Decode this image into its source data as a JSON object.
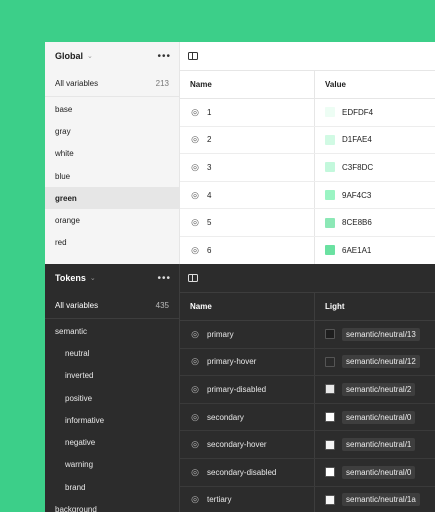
{
  "light_panel": {
    "collection_name": "Global",
    "all_variables_label": "All variables",
    "all_variables_count": "213",
    "groups": [
      {
        "label": "base",
        "selected": false
      },
      {
        "label": "gray",
        "selected": false
      },
      {
        "label": "white",
        "selected": false
      },
      {
        "label": "blue",
        "selected": false
      },
      {
        "label": "green",
        "selected": true
      },
      {
        "label": "orange",
        "selected": false
      },
      {
        "label": "red",
        "selected": false
      }
    ],
    "columns": {
      "name": "Name",
      "value": "Value"
    },
    "rows": [
      {
        "name": "1",
        "value": "EDFDF4",
        "color": "#EDFDF4"
      },
      {
        "name": "2",
        "value": "D1FAE4",
        "color": "#D1FAE4"
      },
      {
        "name": "3",
        "value": "C3F8DC",
        "color": "#C3F8DC"
      },
      {
        "name": "4",
        "value": "9AF4C3",
        "color": "#9AF4C3"
      },
      {
        "name": "5",
        "value": "8CE8B6",
        "color": "#8CE8B6"
      },
      {
        "name": "6",
        "value": "6AE1A1",
        "color": "#6AE1A1"
      }
    ]
  },
  "dark_panel": {
    "collection_name": "Tokens",
    "all_variables_label": "All variables",
    "all_variables_count": "435",
    "groups": [
      {
        "label": "semantic",
        "sub": false
      },
      {
        "label": "neutral",
        "sub": true
      },
      {
        "label": "inverted",
        "sub": true
      },
      {
        "label": "positive",
        "sub": true
      },
      {
        "label": "informative",
        "sub": true
      },
      {
        "label": "negative",
        "sub": true
      },
      {
        "label": "warning",
        "sub": true
      },
      {
        "label": "brand",
        "sub": true
      },
      {
        "label": "background",
        "sub": false
      }
    ],
    "columns": {
      "name": "Name",
      "light": "Light"
    },
    "rows": [
      {
        "name": "primary",
        "alias": "semantic/neutral/13",
        "color": "#1e1e1e"
      },
      {
        "name": "primary-hover",
        "alias": "semantic/neutral/12",
        "color": "#2a2a2a"
      },
      {
        "name": "primary-disabled",
        "alias": "semantic/neutral/2",
        "color": "#e8e8e8"
      },
      {
        "name": "secondary",
        "alias": "semantic/neutral/0",
        "color": "#ffffff"
      },
      {
        "name": "secondary-hover",
        "alias": "semantic/neutral/1",
        "color": "#f5f5f5"
      },
      {
        "name": "secondary-disabled",
        "alias": "semantic/neutral/0",
        "color": "#ffffff"
      },
      {
        "name": "tertiary",
        "alias": "semantic/neutral/1a",
        "color": "#f7f7f7"
      }
    ]
  },
  "colors": {
    "background": "#3ccf89"
  },
  "icons": {
    "more": "more-horizontal-icon",
    "sidebar_toggle": "sidebar-toggle-icon",
    "variable": "color-variable-icon",
    "chevron": "chevron-down-icon"
  }
}
